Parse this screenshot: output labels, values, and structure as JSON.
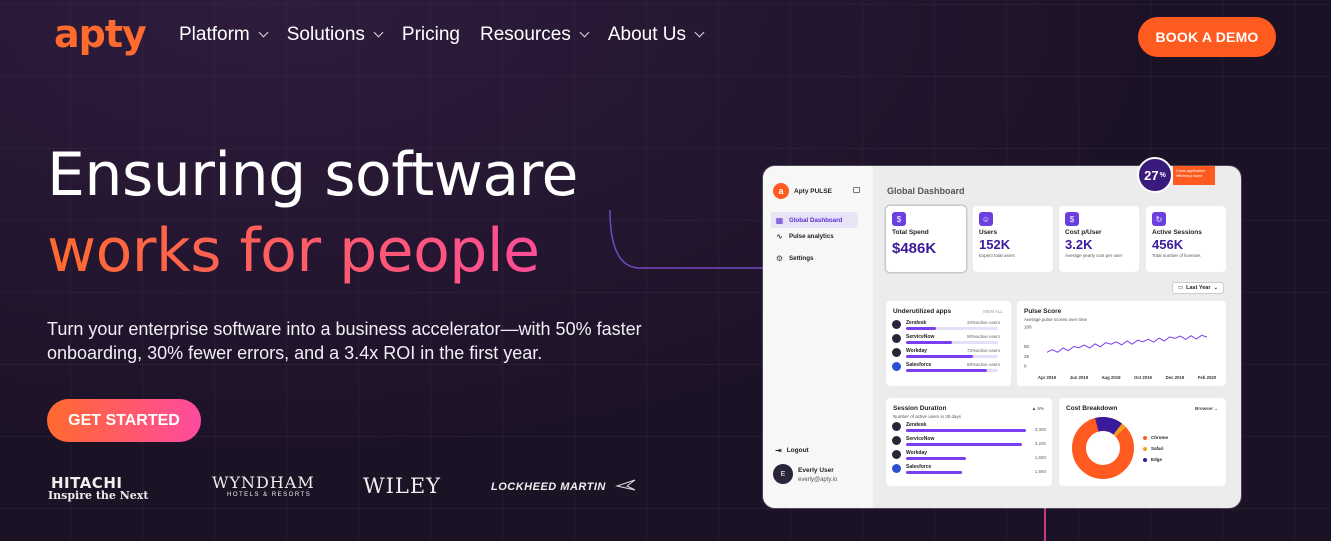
{
  "brand": {
    "logo_text": "apty"
  },
  "nav": {
    "items": [
      {
        "label": "Platform",
        "has_dropdown": true
      },
      {
        "label": "Solutions",
        "has_dropdown": true
      },
      {
        "label": "Pricing",
        "has_dropdown": false
      },
      {
        "label": "Resources",
        "has_dropdown": true
      },
      {
        "label": "About Us",
        "has_dropdown": true
      }
    ],
    "cta_label": "BOOK A DEMO"
  },
  "hero": {
    "title_line1": "Ensuring software",
    "title_line2": "works for people",
    "subtitle": "Turn your enterprise software into a business accelerator—with 50% faster onboarding, 30% fewer errors, and a 3.4x ROI in the first year.",
    "cta_label": "GET STARTED"
  },
  "client_logos": {
    "hitachi": "HITACHI",
    "hitachi_tagline": "Inspire the Next",
    "wyndham": "WYNDHAM",
    "wyndham_tagline": "HOTELS & RESORTS",
    "wiley": "WILEY",
    "lockheed": "LOCKHEED MARTIN"
  },
  "colors": {
    "background": "#1c1226",
    "accent_orange": "#ff5a1f",
    "accent_pink": "#ff4aa0",
    "accent_purple": "#7a3ff0"
  },
  "dashboard": {
    "badge_value": "27",
    "badge_unit": "%",
    "badge_tag": "Costs application efficiency boost",
    "sidebar": {
      "brand": "Apty PULSE",
      "items": [
        {
          "label": "Global Dashboard",
          "icon": "grid-icon",
          "active": true
        },
        {
          "label": "Pulse analytics",
          "icon": "pulse-icon",
          "active": false
        },
        {
          "label": "Settings",
          "icon": "gear-icon",
          "active": false
        }
      ],
      "logout_label": "Logout",
      "user_initial": "E",
      "user_name": "Everly User",
      "user_email": "everly@apty.io"
    },
    "title": "Global Dashboard",
    "kpis": [
      {
        "label": "Total Spend",
        "value": "$486K",
        "note": ""
      },
      {
        "label": "Users",
        "value": "152K",
        "note": "Expect total users"
      },
      {
        "label": "Cost p/User",
        "value": "3.2K",
        "note": "Average yearly cost per user"
      },
      {
        "label": "Active Sessions",
        "value": "456K",
        "note": "Total number of licenses"
      }
    ],
    "period_select": "Last Year",
    "underutilized": {
      "title": "Underutilized apps",
      "view_all": "VIEW ALL",
      "apps": [
        {
          "name": "Zendesk",
          "users": "33%active users",
          "percent": 33
        },
        {
          "name": "ServiceNow",
          "users": "50%active users",
          "percent": 50
        },
        {
          "name": "Workday",
          "users": "73%active users",
          "percent": 73
        },
        {
          "name": "Salesforce",
          "users": "88%active users",
          "percent": 88
        }
      ]
    },
    "pulse_score": {
      "title": "Pulse Score",
      "subtitle": "Average pulse scores over time",
      "y_ticks": [
        "100",
        "50",
        "25",
        "0"
      ],
      "x_ticks": [
        "Apr 2019",
        "Jun 2019",
        "Aug 2019",
        "Oct 2019",
        "Dec 2019",
        "Feb 2020"
      ]
    },
    "session_duration": {
      "title": "Session Duration",
      "subtitle": "Number of active users in 30 days",
      "delta": "▲ 5%",
      "apps": [
        {
          "name": "Zendesk",
          "value": "3,300",
          "percent": 100
        },
        {
          "name": "ServiceNow",
          "value": "3,200",
          "percent": 97
        },
        {
          "name": "Workday",
          "value": "1,650",
          "percent": 50
        },
        {
          "name": "Salesforce",
          "value": "1,560",
          "percent": 47
        }
      ]
    },
    "cost_breakdown": {
      "title": "Cost Breakdown",
      "select": "Browser",
      "legend": [
        {
          "label": "Chrome",
          "color": "#ff5a1f"
        },
        {
          "label": "Safari",
          "color": "#f0a020"
        },
        {
          "label": "Edge",
          "color": "#3a1a9c"
        }
      ]
    }
  },
  "chart_data": {
    "type": "line",
    "title": "Pulse Score",
    "subtitle": "Average pulse scores over time",
    "x": [
      "Apr 2019",
      "Jun 2019",
      "Aug 2019",
      "Oct 2019",
      "Dec 2019",
      "Feb 2020"
    ],
    "ylim": [
      0,
      100
    ],
    "series": [
      {
        "values": [
          35,
          47,
          56,
          62,
          71,
          74
        ]
      }
    ]
  }
}
